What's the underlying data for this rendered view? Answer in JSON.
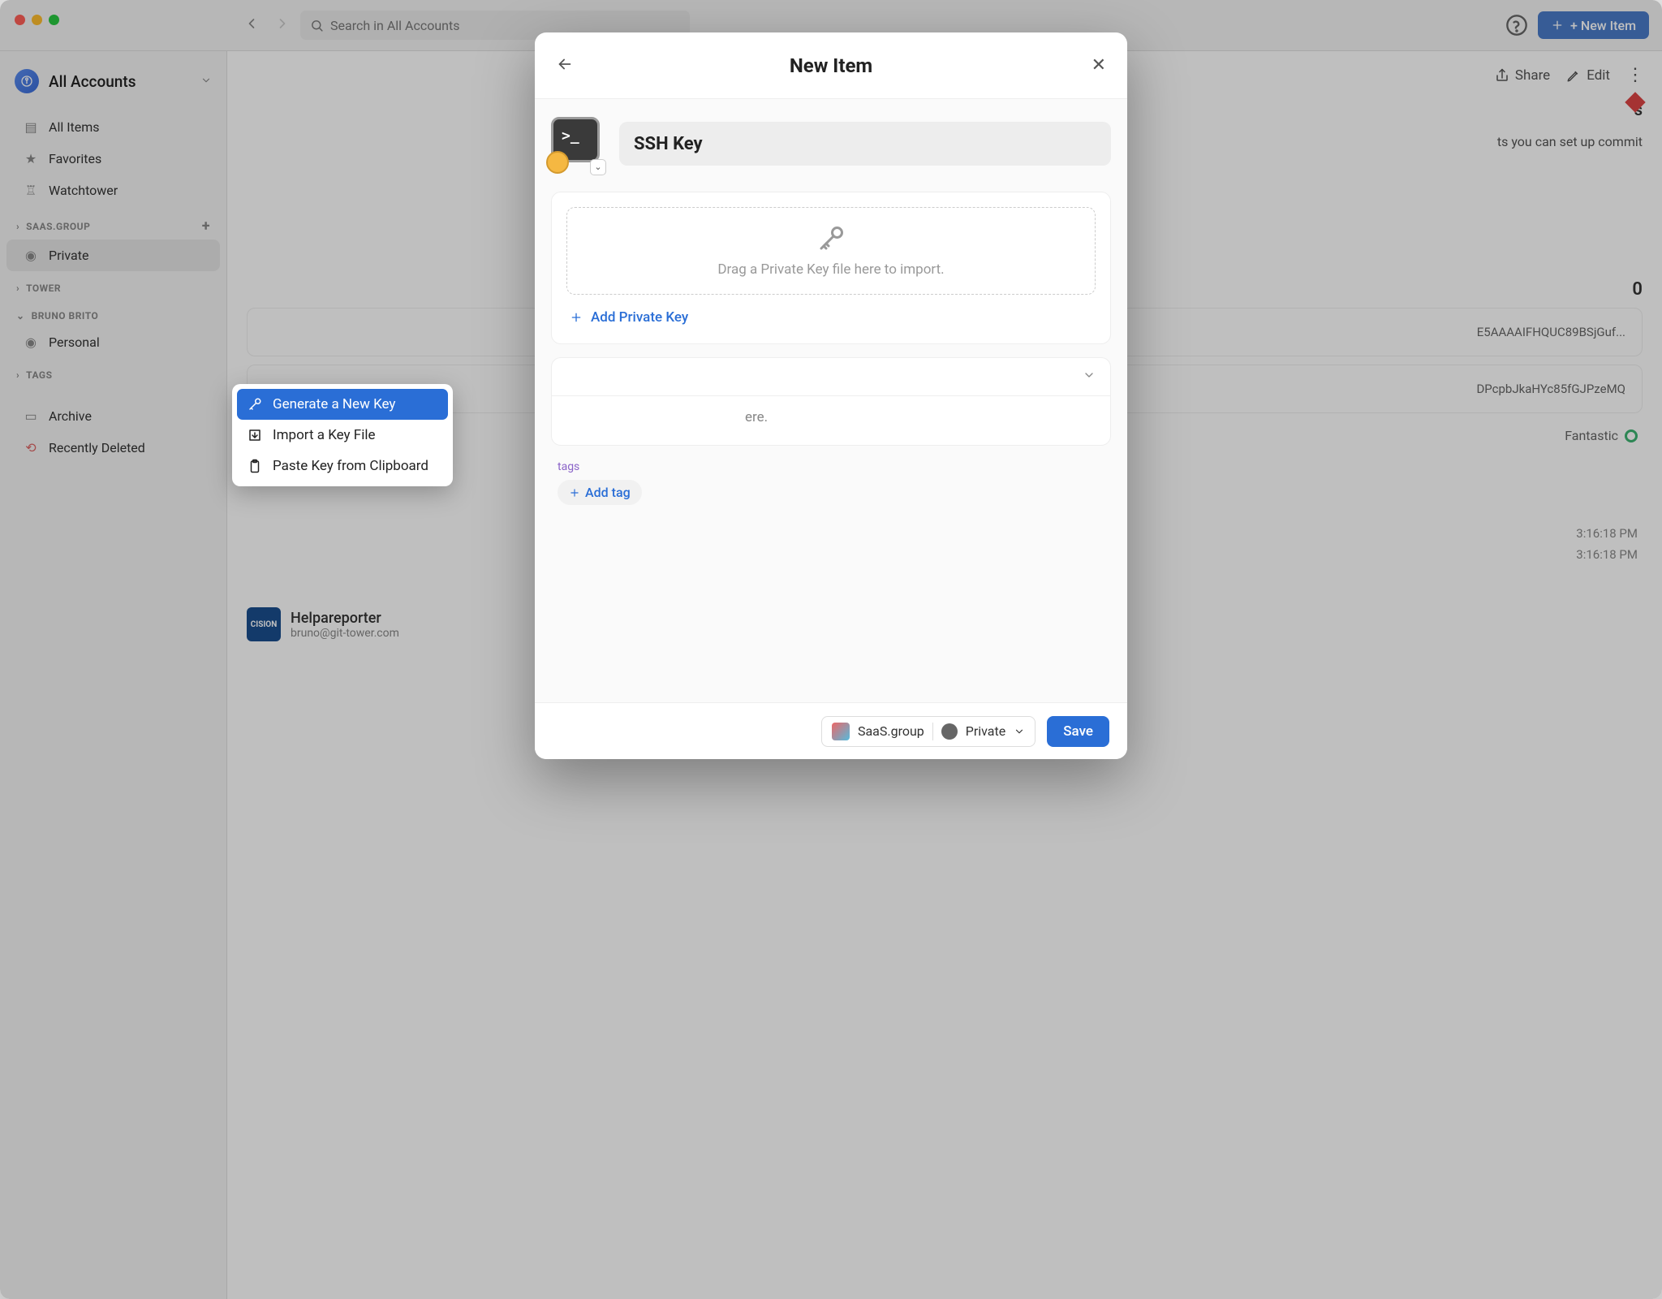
{
  "topbar": {
    "search_placeholder": "Search in All Accounts",
    "new_item_label": "+  New Item"
  },
  "toolbar": {
    "share": "Share",
    "edit": "Edit"
  },
  "sidebar": {
    "account_label": "All Accounts",
    "all_items": "All Items",
    "favorites": "Favorites",
    "watchtower": "Watchtower",
    "section_saas": "SAAS.GROUP",
    "private": "Private",
    "section_bruno": "BRUNO BRITO",
    "personal": "Personal",
    "section_tower": "TOWER",
    "section_tags": "TAGS",
    "archive": "Archive",
    "recently_deleted": "Recently Deleted"
  },
  "content_bg": {
    "title_suffix": "s",
    "hint": "ts you can set up commit",
    "field1": "E5AAAAIFHQUC89BSjGuf...",
    "field2": "DPcpbJkaHYc85fGJPzeMQ",
    "status": "Fantastic",
    "time1": "3:16:18 PM",
    "time2": "3:16:18 PM",
    "list_title": "Helpareporter",
    "list_sub": "bruno@git-tower.com",
    "list_badge": "CISION"
  },
  "modal": {
    "title": "New Item",
    "item_title": "SSH Key",
    "dropzone": "Drag a Private Key file here to import.",
    "add_key": "Add Private Key",
    "notes_placeholder": "ere.",
    "tags_label": "tags",
    "add_tag": "Add tag",
    "footer_account": "SaaS.group",
    "footer_vault": "Private",
    "save": "Save"
  },
  "popup": {
    "generate": "Generate a New Key",
    "import": "Import a Key File",
    "paste": "Paste Key from Clipboard"
  }
}
